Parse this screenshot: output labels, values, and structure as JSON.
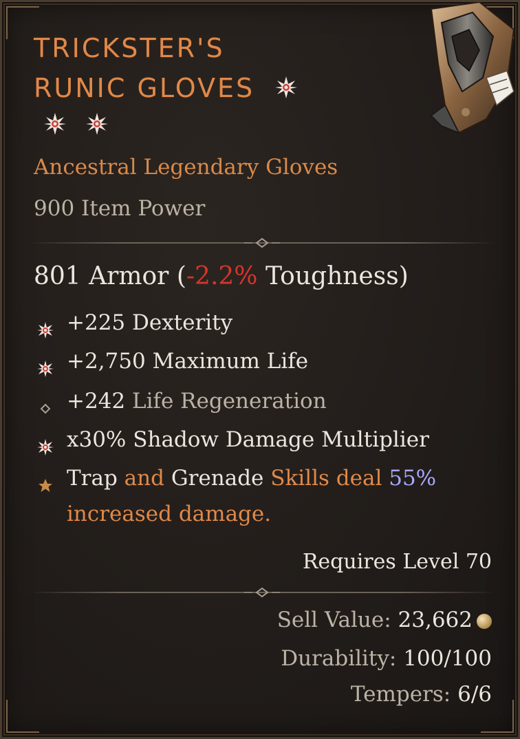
{
  "item": {
    "name_line1": "TRICKSTER'S",
    "name_line2": "RUNIC GLOVES",
    "subtype": "Ancestral Legendary Gloves",
    "item_power": "900 Item Power",
    "icon": "gloves-icon"
  },
  "armor": {
    "prefix": "801 Armor (",
    "toughness_change": "-2.2%",
    "suffix": " Toughness)"
  },
  "affixes": [
    {
      "bullet": "greater-affix-icon",
      "text": "+225 Dexterity"
    },
    {
      "bullet": "greater-affix-icon",
      "text": "+2,750 Maximum Life"
    },
    {
      "bullet": "affix-diamond-icon",
      "value": "+242",
      "name": " Life Regeneration"
    },
    {
      "bullet": "greater-affix-icon",
      "text": "x30% Shadow Damage Multiplier"
    }
  ],
  "aspect": {
    "bullet": "legendary-star-icon",
    "part1": "Trap",
    "part2": " and ",
    "part3": "Grenade",
    "part4": " Skills deal ",
    "part5": "55%",
    "part6": "increased damage."
  },
  "requires_level": "Requires Level 70",
  "sell": {
    "label": "Sell Value: ",
    "value": "23,662",
    "icon": "gold-coin-icon"
  },
  "durability": {
    "label": "Durability: ",
    "value": "100/100"
  },
  "tempers": {
    "label": "Tempers: ",
    "value": "6/6"
  },
  "colors": {
    "legendary_orange": "#e0894a",
    "negative_red": "#d4362c",
    "value_blue": "#a8a8ff",
    "text_white": "#ece6de",
    "text_grey": "#bcb3a6"
  }
}
